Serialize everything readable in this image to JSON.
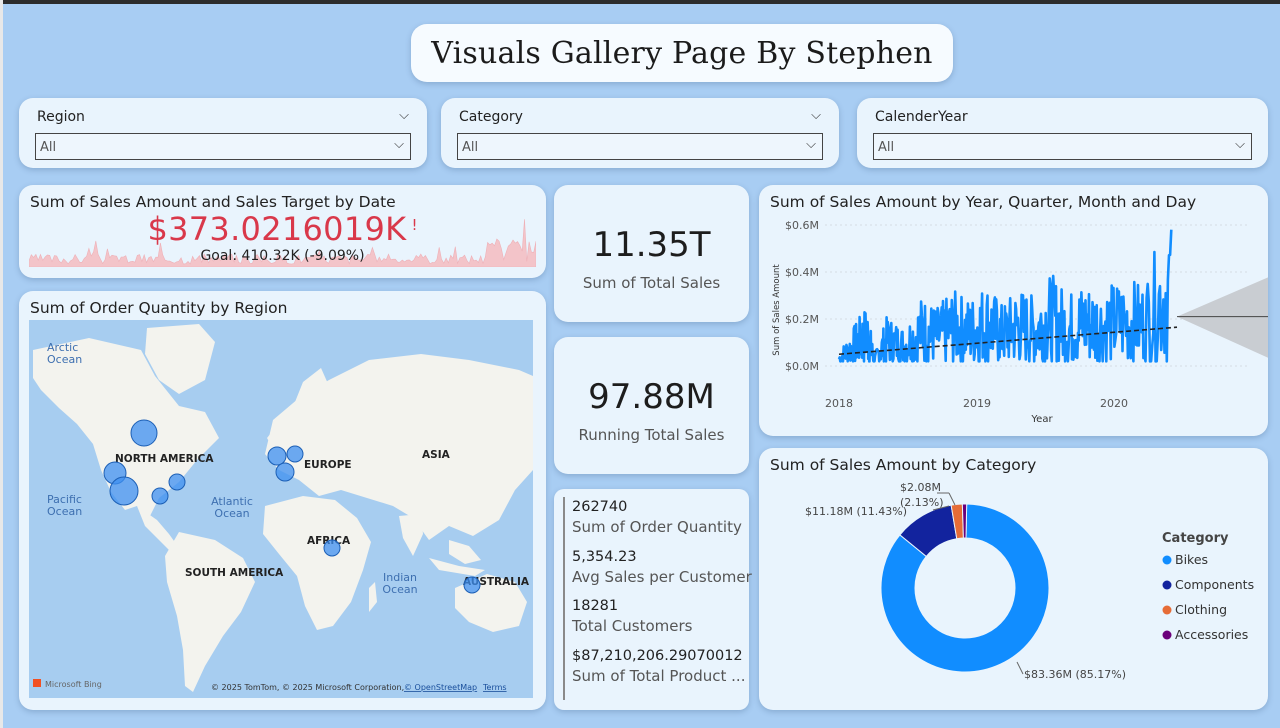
{
  "page_title": "Visuals Gallery Page By Stephen",
  "slicers": [
    {
      "label": "Region",
      "value": "All"
    },
    {
      "label": "Category",
      "value": "All"
    },
    {
      "label": "CalenderYear",
      "value": "All"
    }
  ],
  "target_card": {
    "title": "Sum of Sales Amount and Sales Target by Date",
    "value": "$373.0216019K",
    "alert": "!",
    "goal": "Goal: 410.32K (-9.09%)"
  },
  "kpi_total_sales": {
    "value": "11.35T",
    "label": "Sum of Total Sales"
  },
  "kpi_running_total": {
    "value": "97.88M",
    "label": "Running Total Sales"
  },
  "multi_row_card": [
    {
      "value": "262740",
      "label": "Sum of Order Quantity"
    },
    {
      "value": "5,354.23",
      "label": "Avg Sales per Customer"
    },
    {
      "value": "18281",
      "label": "Total Customers"
    },
    {
      "value": "$87,210,206.29070012",
      "label": "Sum of Total Product ..."
    }
  ],
  "map": {
    "title": "Sum of Order Quantity by Region",
    "labels": {
      "arctic": [
        "Arctic",
        "Ocean"
      ],
      "pacific": [
        "Pacific",
        "Ocean"
      ],
      "atlantic": [
        "Atlantic",
        "Ocean"
      ],
      "indian": [
        "Indian",
        "Ocean"
      ],
      "north_america": "NORTH AMERICA",
      "south_america": "SOUTH AMERICA",
      "europe": "EUROPE",
      "asia": "ASIA",
      "africa": "AFRICA",
      "australia": "AUSTRALIA"
    },
    "bing": "Microsoft Bing",
    "copyright": "© 2025 TomTom, © 2025 Microsoft Corporation,",
    "osm": "© OpenStreetMap",
    "terms": "Terms"
  },
  "line_chart": {
    "title": "Sum of Sales Amount by Year, Quarter, Month and Day",
    "ylabel": "Sum of Sales Amount",
    "xlabel": "Year",
    "y_ticks": [
      "$0.6M",
      "$0.4M",
      "$0.2M",
      "$0.0M"
    ],
    "x_ticks": [
      "2018",
      "2019",
      "2020"
    ]
  },
  "donut_chart": {
    "title": "Sum of Sales Amount by Category",
    "legend_title": "Category",
    "labels": {
      "bikes": "$83.36M (85.17%)",
      "components": "$11.18M (11.43%)",
      "accessories_1": "$2.08M",
      "accessories_2": "(2.13%)"
    }
  },
  "chart_data": [
    {
      "type": "line",
      "title": "Sum of Sales Amount by Year, Quarter, Month and Day",
      "xlabel": "Year",
      "ylabel": "Sum of Sales Amount",
      "ylim": [
        0,
        600000
      ],
      "x_range": [
        "2018-01-01",
        "2020-07-31"
      ],
      "x_ticks": [
        "2018",
        "2019",
        "2020"
      ],
      "y_ticks": [
        "$0.0M",
        "$0.2M",
        "$0.4M",
        "$0.6M"
      ],
      "trend_line": {
        "start": {
          "x": "2018-01-01",
          "y": 50000
        },
        "end": {
          "x": "2020-07-31",
          "y": 165000
        }
      },
      "forecast": {
        "x_range": [
          "2020-08-01",
          "2021-06-30"
        ],
        "value": 210000,
        "upper_end": 430000,
        "lower_end": -20000
      },
      "series": [
        {
          "values": [
            {
              "x": "2018-01-01",
              "y": 50000
            },
            {
              "x": "2018-02-15",
              "y": 150000
            },
            {
              "x": "2018-03-20",
              "y": 220000
            },
            {
              "x": "2018-04-10",
              "y": 40000
            },
            {
              "x": "2018-05-15",
              "y": 180000
            },
            {
              "x": "2018-07-01",
              "y": 140000
            },
            {
              "x": "2018-08-20",
              "y": 250000
            },
            {
              "x": "2018-10-01",
              "y": 210000
            },
            {
              "x": "2018-11-15",
              "y": 270000
            },
            {
              "x": "2019-01-01",
              "y": 240000
            },
            {
              "x": "2019-02-15",
              "y": 300000
            },
            {
              "x": "2019-04-01",
              "y": 220000
            },
            {
              "x": "2019-05-15",
              "y": 280000
            },
            {
              "x": "2019-07-01",
              "y": 250000
            },
            {
              "x": "2019-08-15",
              "y": 330000
            },
            {
              "x": "2019-10-01",
              "y": 260000
            },
            {
              "x": "2019-11-15",
              "y": 300000
            },
            {
              "x": "2020-01-01",
              "y": 280000
            },
            {
              "x": "2020-03-01",
              "y": 310000
            },
            {
              "x": "2020-05-01",
              "y": 300000
            },
            {
              "x": "2020-07-15",
              "y": 580000
            }
          ]
        }
      ]
    },
    {
      "type": "pie",
      "donut": true,
      "title": "Sum of Sales Amount by Category",
      "categories": [
        "Bikes",
        "Components",
        "Clothing",
        "Accessories"
      ],
      "values": [
        83.36,
        11.18,
        2.08,
        0.8
      ],
      "unit": "$M",
      "colors": [
        "#118dff",
        "#12239e",
        "#e66c37",
        "#6b007b"
      ],
      "legend_title": "Category",
      "legend_position": "right"
    },
    {
      "type": "area",
      "title": "Sum of Sales Amount and Sales Target by Date",
      "value": 373021.6019,
      "goal": 410320,
      "variance_pct": -9.09
    }
  ]
}
